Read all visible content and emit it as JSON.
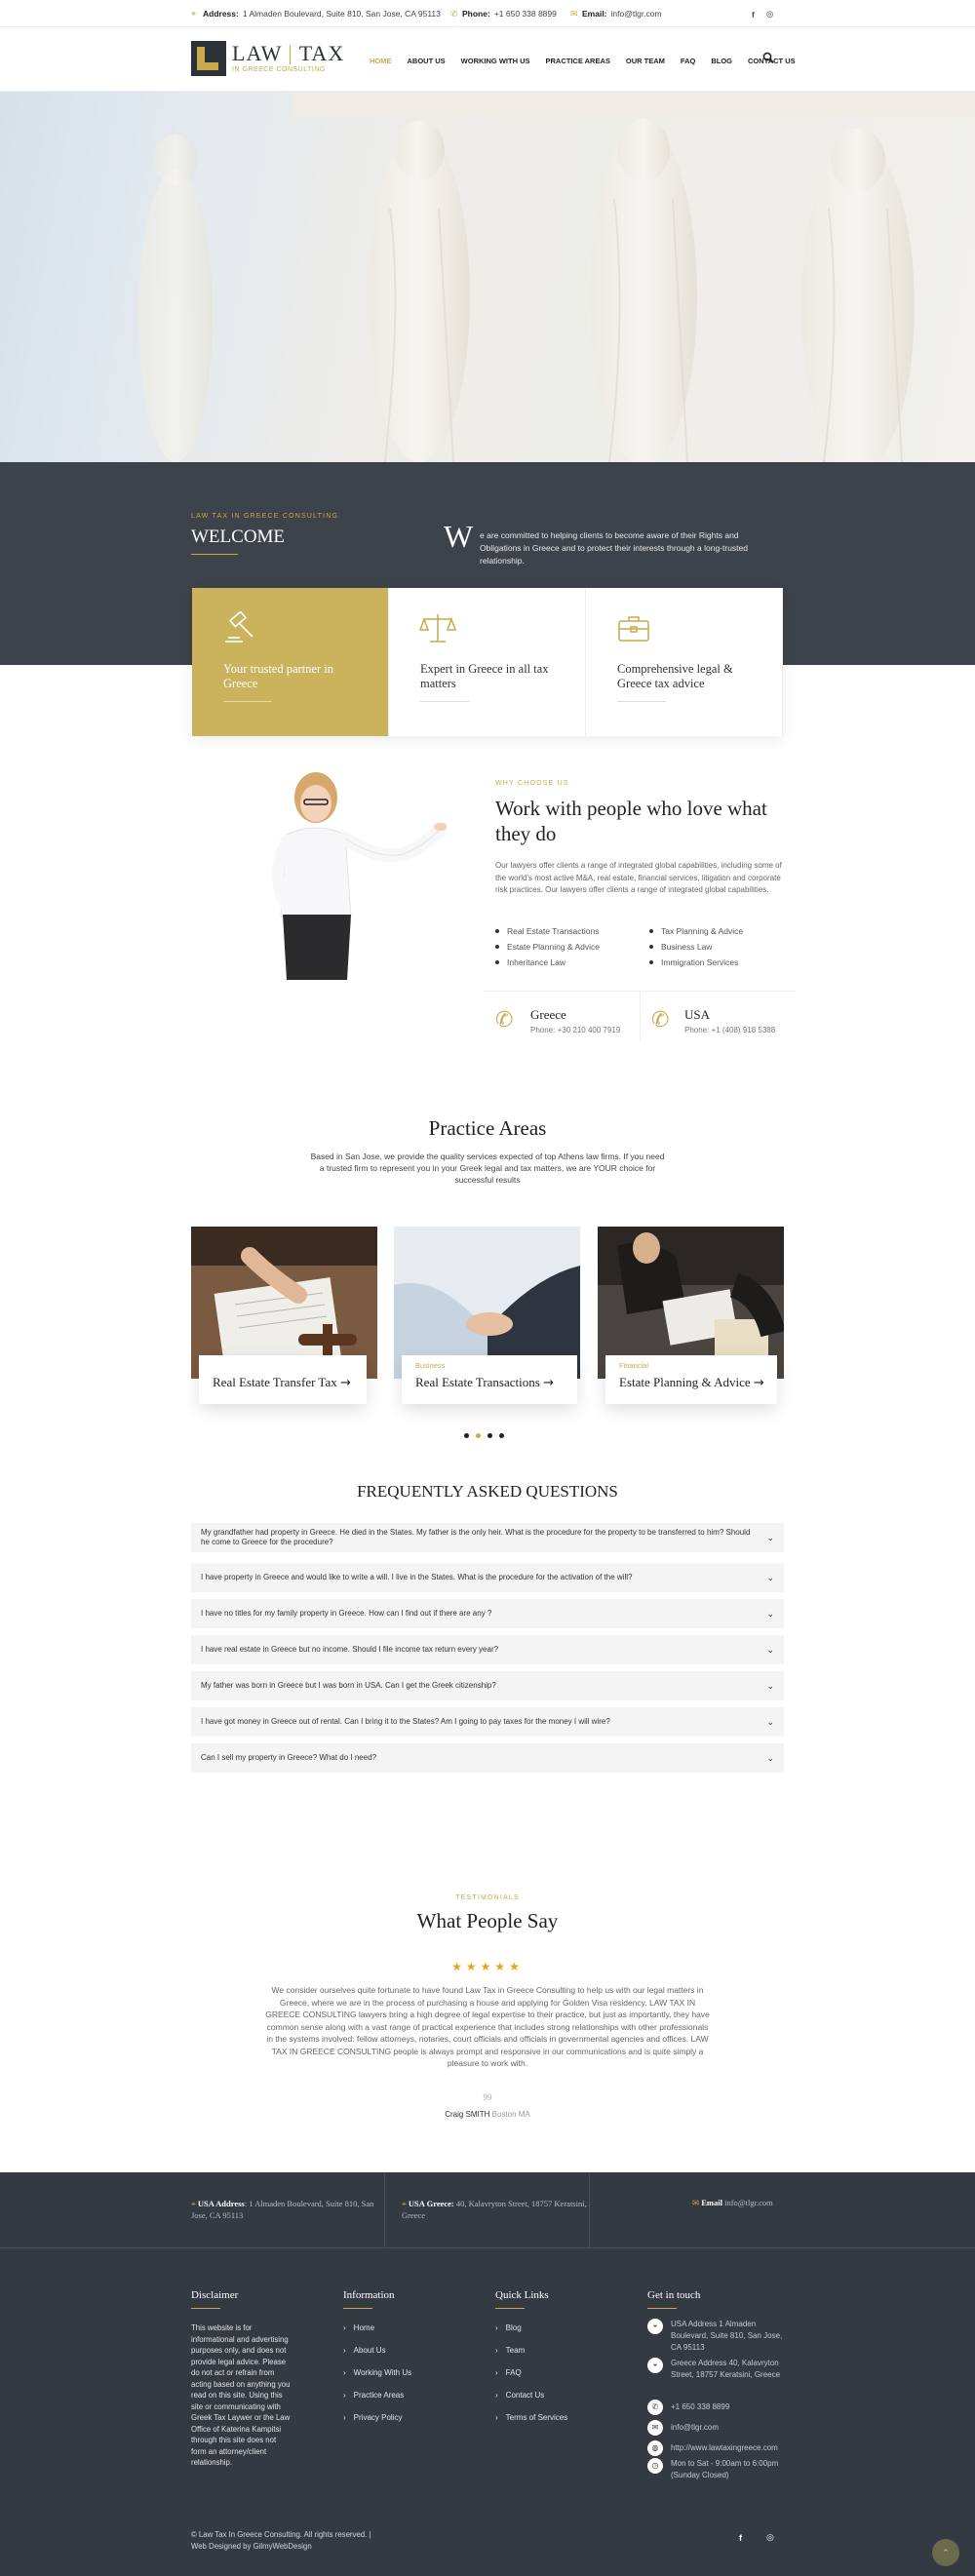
{
  "topbar": {
    "address_label": "Address:",
    "address": "1 Almaden Boulevard, Suite 810, San Jose, CA 95113",
    "phone_label": "Phone:",
    "phone": "+1 650 338 8899",
    "email_label": "Email:",
    "email": "info@tlgr.com",
    "social": [
      "facebook-icon",
      "instagram-icon"
    ]
  },
  "brand": {
    "word1": "LAW",
    "word2": "TAX",
    "tagline": "IN GREECE CONSULTING",
    "accent": "#c9a94b"
  },
  "nav": [
    "HOME",
    "ABOUT US",
    "WORKING WITH US",
    "PRACTICE AREAS",
    "OUR TEAM",
    "FAQ",
    "BLOG",
    "CONTACT US"
  ],
  "welcome": {
    "kicker": "LAW TAX IN GREECE CONSULTING",
    "title": "WELCOME",
    "dropcap": "W",
    "text": "e are committed to helping clients to become aware of their Rights and Obligations in Greece and to protect their interests through a long-trusted relationship."
  },
  "features": [
    {
      "title": "Your trusted partner in Greece",
      "icon": "gavel-icon"
    },
    {
      "title": "Expert in Greece in all tax matters",
      "icon": "scales-icon"
    },
    {
      "title": "Comprehensive legal & Greece tax advice",
      "icon": "briefcase-icon"
    }
  ],
  "why": {
    "kicker": "WHY CHOOSE US",
    "title": "Work with people who love what they do",
    "text": "Our lawyers offer clients a range of integrated global capabilities, including some of the world's most active M&A, real estate, financial services, litigation and corporate risk practices. Our lawyers offer clients a range of integrated global capabilities.",
    "bullets_left": [
      "Real Estate Transactions",
      "Estate Planning & Advice",
      "Inheritance Law"
    ],
    "bullets_right": [
      "Tax Planning & Advice",
      "Business Law",
      "Immigration Services"
    ],
    "contacts": [
      {
        "title": "Greece",
        "phone": "Phone: +30 210 400 7919"
      },
      {
        "title": "USA",
        "phone": "Phone: +1 (408) 918 5388"
      }
    ]
  },
  "practice": {
    "title": "Practice Areas",
    "text": "Based in San Jose, we provide the quality services expected of top Athens law firms. If you need a trusted firm to represent you in your Greek legal and tax matters, we are YOUR choice for successful results",
    "cards": [
      {
        "category": "",
        "name": "Real Estate Transfer Tax"
      },
      {
        "category": "Business",
        "name": "Real Estate Transactions"
      },
      {
        "category": "Financial",
        "name": "Estate Planning & Advice"
      }
    ]
  },
  "faq": {
    "title": "FREQUENTLY ASKED QUESTIONS",
    "items": [
      "My grandfather had property in Greece. He died in the States. My father is the only heir. What is the procedure for the property to be transferred to him? Should he come to Greece for the procedure?",
      "I have property in Greece and would like to write a will. I live in the States. What is the procedure for the activation of the will?",
      "I have no titles for my family property in Greece. How can I find out if there are any ?",
      "I have real estate in Greece but no income. Should I file income tax return every year?",
      "My father was born in Greece but I was born in USA. Can I get the Greek citizenship?",
      "I have got money in Greece out of rental. Can I bring it to the States? Am I going to pay taxes for the money I will wire?",
      "Can I sell my property in Greece? What do I need?"
    ]
  },
  "testimonials": {
    "kicker": "TESTIMONIALS",
    "title": "What People Say",
    "stars": 5,
    "quote": "We consider ourselves quite fortunate to have found Law Tax in Greece Consulting to help us with our legal matters in Greece, where we are in the process of purchasing a house and applying for Golden Visa residency. LAW TAX IN GREECE CONSULTING lawyers bring a high degree of legal expertise to their practice, but just as importantly, they have common sense along with a vast range of practical experience that includes strong relationships with other professionals in the systems involved: fellow attorneys, notaries, court officials and officials in governmental agencies and offices. LAW TAX IN GREECE CONSULTING people is always prompt and responsive in our communications and is quite simply a pleasure to work with.",
    "quote_mark": "99",
    "author": "Craig SMITH",
    "author_location": "Boston MA"
  },
  "footer_top": {
    "usa_label": "USA Address",
    "usa": ": 1 Almaden Boulevard, Suite 810, San Jose, CA 95113",
    "greece_label": "USA Greece:",
    "greece": " 40, Kalavryton Street, 18757 Keratsini, Greece",
    "email_label": "Email",
    "email": " info@tlgr.com"
  },
  "footer": {
    "disclaimer_title": "Disclaimer",
    "disclaimer": "This website is for informational and advertising purposes only, and does not provide legal advice. Please do not act or refrain from acting based on anything you read on this site. Using this site or communicating with Greek Tax Laywer or the Law Office of Katerina Kampitsi through this site does not form an attorney/client relationship.",
    "info_title": "Information",
    "info_links": [
      "Home",
      "About Us",
      "Working With Us",
      "Practice Areas",
      "Privacy Policy"
    ],
    "quick_title": "Quick Links",
    "quick_links": [
      "Blog",
      "Team",
      "FAQ",
      "Contact Us",
      "Terms of Services"
    ],
    "touch_title": "Get in touch",
    "touch": [
      {
        "icon": "location-icon",
        "text": "USA Address 1 Almaden Boulevard, Suite 810, San Jose, CA 95113"
      },
      {
        "icon": "location-icon",
        "text": "Greece Address 40, Kalavryton Street, 18757 Keratsini, Greece"
      },
      {
        "icon": "phone-icon",
        "text": "+1 650 338 8899"
      },
      {
        "icon": "email-icon",
        "text": "info@tlgr.com"
      },
      {
        "icon": "globe-icon",
        "text": "http://www.lawtaxingreece.com"
      },
      {
        "icon": "clock-icon",
        "text": "Mon to Sat - 9:00am to 6:00pm (Sunday Closed)"
      }
    ],
    "copyright": "© Law Tax In Greece Consulting. All rights reserved. | Web Designed by GilmyWebDesign"
  }
}
